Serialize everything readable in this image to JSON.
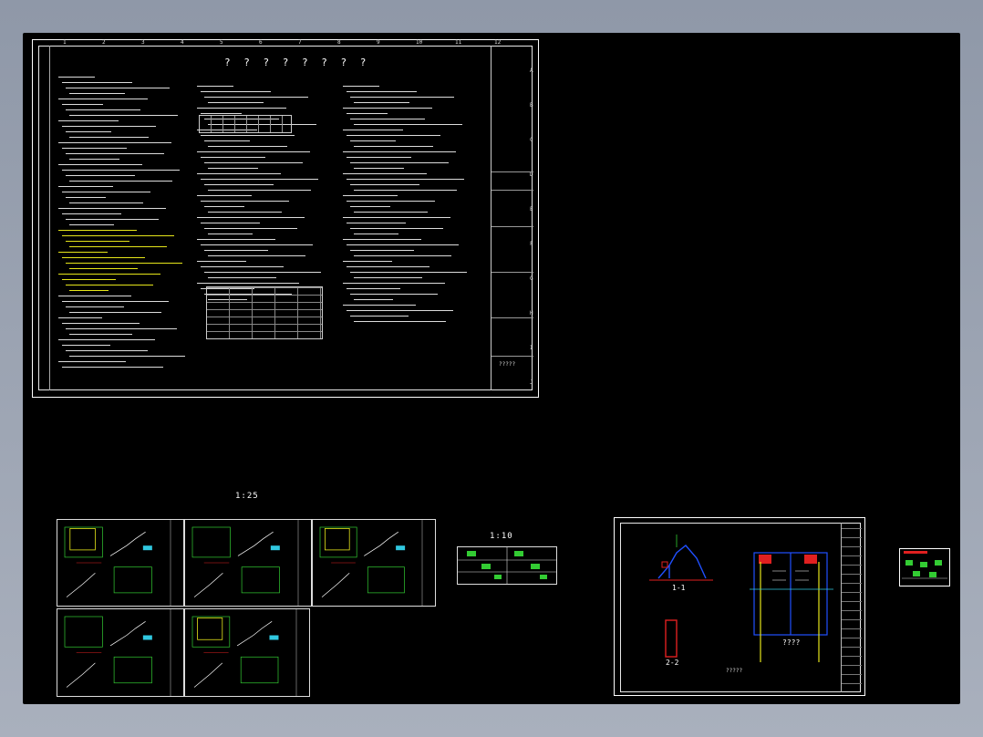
{
  "sheet1": {
    "title": "? ? ? ? ? ? ? ?",
    "col_numbers": [
      "1",
      "2",
      "3",
      "4",
      "5",
      "6",
      "7",
      "8",
      "9",
      "10",
      "11",
      "12"
    ],
    "row_letters": [
      "A",
      "B",
      "C",
      "D",
      "E",
      "F",
      "G",
      "H",
      "I",
      "J"
    ],
    "stamp": "?????"
  },
  "scale_labels": {
    "stairs": "1:25",
    "details": "1:10"
  },
  "sheet3": {
    "section_1": "1-1",
    "section_2": "2-2",
    "plan_label": "????",
    "note": "?????"
  },
  "colors": {
    "background": "#000000",
    "lines": "#ffffff",
    "accent_green": "#33cc33",
    "accent_yellow": "#e6e61a",
    "accent_red": "#e02020",
    "accent_blue": "#2050ff",
    "accent_cyan": "#30c8e0"
  }
}
